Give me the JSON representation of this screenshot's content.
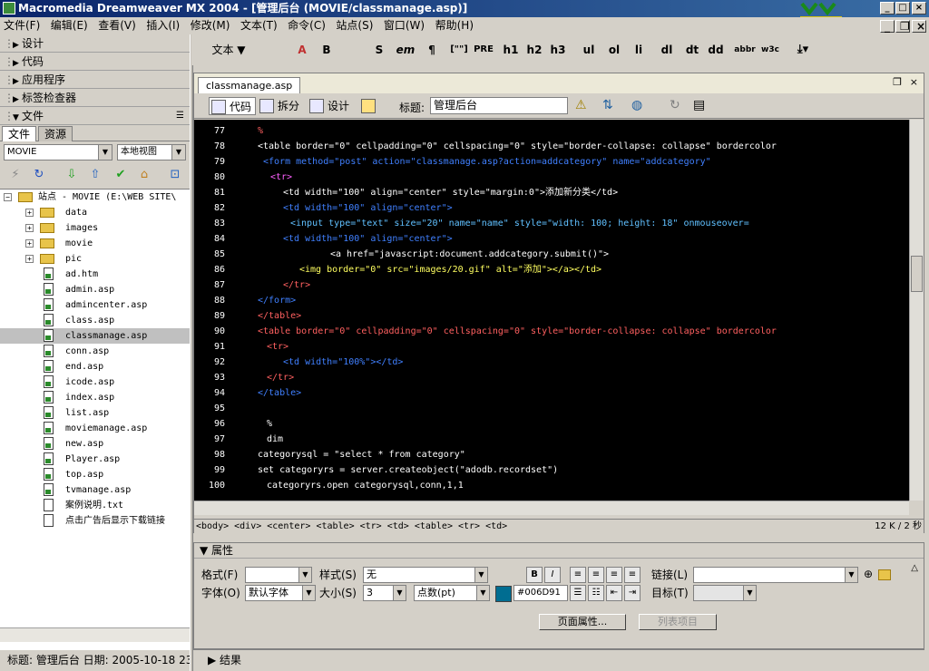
{
  "window": {
    "title": "Macromedia Dreamweaver MX 2004 - [管理后台 (MOVIE/classmanage.asp)]"
  },
  "menu": [
    "文件(F)",
    "编辑(E)",
    "查看(V)",
    "插入(I)",
    "修改(M)",
    "文本(T)",
    "命令(C)",
    "站点(S)",
    "窗口(W)",
    "帮助(H)"
  ],
  "panels": {
    "design": "设计",
    "code": "代码",
    "app": "应用程序",
    "tag": "标签检查器",
    "files": "文件"
  },
  "files_panel": {
    "tab_files": "文件",
    "tab_assets": "资源",
    "site": "MOVIE",
    "view": "本地视图",
    "root": "站点 - MOVIE (E:\\WEB SITE\\",
    "items": [
      {
        "name": "data",
        "type": "folder"
      },
      {
        "name": "images",
        "type": "folder"
      },
      {
        "name": "movie",
        "type": "folder"
      },
      {
        "name": "pic",
        "type": "folder"
      },
      {
        "name": "ad.htm",
        "type": "asp"
      },
      {
        "name": "admin.asp",
        "type": "asp"
      },
      {
        "name": "admincenter.asp",
        "type": "asp"
      },
      {
        "name": "class.asp",
        "type": "asp"
      },
      {
        "name": "classmanage.asp",
        "type": "asp"
      },
      {
        "name": "conn.asp",
        "type": "asp"
      },
      {
        "name": "end.asp",
        "type": "asp"
      },
      {
        "name": "icode.asp",
        "type": "asp"
      },
      {
        "name": "index.asp",
        "type": "asp"
      },
      {
        "name": "list.asp",
        "type": "asp"
      },
      {
        "name": "moviemanage.asp",
        "type": "asp"
      },
      {
        "name": "new.asp",
        "type": "asp"
      },
      {
        "name": "Player.asp",
        "type": "asp"
      },
      {
        "name": "top.asp",
        "type": "asp"
      },
      {
        "name": "tvmanage.asp",
        "type": "asp"
      },
      {
        "name": "案例说明.txt",
        "type": "txt"
      },
      {
        "name": "点击广告后显示下载链接",
        "type": "txt"
      }
    ]
  },
  "left_status": "标题: 管理后台  日期: 2005-10-18 23:",
  "insert": {
    "category": "文本",
    "items": [
      "B",
      "S",
      "em",
      "¶",
      "[\"\"]",
      "PRE",
      "h1",
      "h2",
      "h3",
      "ul",
      "ol",
      "li",
      "dl",
      "dt",
      "dd",
      "abbr",
      "w3c"
    ]
  },
  "doc": {
    "tab": "classmanage.asp",
    "view_code": "代码",
    "view_split": "拆分",
    "view_design": "设计",
    "title_label": "标题:",
    "title_value": "管理后台",
    "tag_selector": "<body> <div> <center> <table> <tr> <td> <table> <tr> <td>",
    "size": "12 K / 2 秒",
    "lines": [
      {
        "n": "77",
        "t": "%"
      },
      {
        "n": "78",
        "t": "<table border=\"0\" cellpadding=\"0\" cellspacing=\"0\" style=\"border-collapse: collapse\" bordercolor"
      },
      {
        "n": "79",
        "t": "<form method=\"post\" action=\"classmanage.asp?action=addcategory\" name=\"addcategory\""
      },
      {
        "n": "80",
        "t": "<tr>"
      },
      {
        "n": "81",
        "t": "<td width=\"100\" align=\"center\" style=\"margin:0\">添加新分类</td>"
      },
      {
        "n": "82",
        "t": "<td width=\"100\" align=\"center\">"
      },
      {
        "n": "83",
        "t": "<input type=\"text\" size=\"20\" name=\"name\" style=\"width: 100; height: 18\" onmouseover="
      },
      {
        "n": "84",
        "t": "<td width=\"100\" align=\"center\">"
      },
      {
        "n": "85",
        "t": "<a href=\"javascript:document.addcategory.submit()\">"
      },
      {
        "n": "86",
        "t": "<img border=\"0\" src=\"images/20.gif\" alt=\"添加\"></a></td>"
      },
      {
        "n": "87",
        "t": "</tr>"
      },
      {
        "n": "88",
        "t": "</form>"
      },
      {
        "n": "89",
        "t": "</table>"
      },
      {
        "n": "90",
        "t": "<table border=\"0\" cellpadding=\"0\" cellspacing=\"0\" style=\"border-collapse: collapse\" bordercolor"
      },
      {
        "n": "91",
        "t": "<tr>"
      },
      {
        "n": "92",
        "t": "<td width=\"100%\"></td>"
      },
      {
        "n": "93",
        "t": "</tr>"
      },
      {
        "n": "94",
        "t": "</table>"
      },
      {
        "n": "95",
        "t": ""
      },
      {
        "n": "96",
        "t": "%"
      },
      {
        "n": "97",
        "t": "dim"
      },
      {
        "n": "98",
        "t": "categorysql = \"select * from category\""
      },
      {
        "n": "99",
        "t": "set categoryrs = server.createobject(\"adodb.recordset\")"
      },
      {
        "n": "100",
        "t": "categoryrs.open categorysql,conn,1,1"
      }
    ]
  },
  "props": {
    "title": "属性",
    "format_label": "格式(F)",
    "format_value": "",
    "style_label": "样式(S)",
    "style_value": "无",
    "link_label": "链接(L)",
    "link_value": "",
    "font_label": "字体(O)",
    "font_value": "默认字体",
    "size_label": "大小(S)",
    "size_value": "3",
    "unit_value": "点数(pt)",
    "color_value": "#006D91",
    "target_label": "目标(T)",
    "page_props": "页面属性...",
    "list_item": "列表项目"
  },
  "results": "结果",
  "colors": {
    "code_bg": "#000000",
    "accent": "#006D91"
  }
}
